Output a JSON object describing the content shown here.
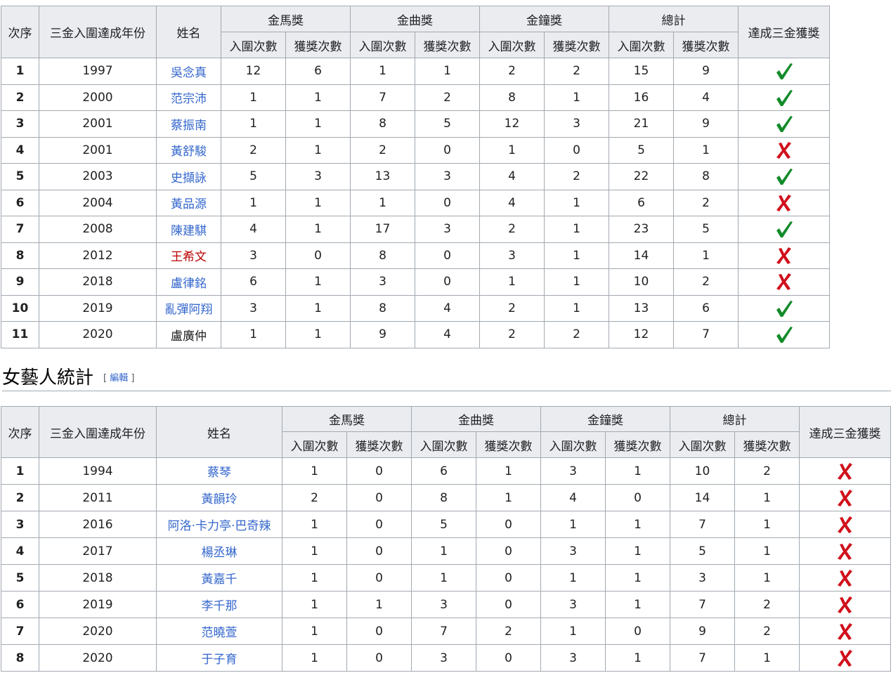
{
  "columns": {
    "order": "次序",
    "year": "三金入圍達成年份",
    "name": "姓名",
    "golden_horse": "金馬獎",
    "golden_melody": "金曲獎",
    "golden_bell": "金鐘獎",
    "total": "總計",
    "achieved": "達成三金獲獎",
    "nominations": "入圍次數",
    "wins": "獲獎次數"
  },
  "marks": {
    "yes": "check-icon",
    "no": "cross-icon",
    "yes_color": "#138b2a",
    "no_color": "#d0101b"
  },
  "male_table": {
    "rows": [
      {
        "order": "1",
        "year": "1997",
        "name": "吳念真",
        "link": "blue",
        "horse_n": "12",
        "horse_w": "6",
        "melody_n": "1",
        "melody_w": "1",
        "bell_n": "2",
        "bell_w": "2",
        "total_n": "15",
        "total_w": "9",
        "achieved": true
      },
      {
        "order": "2",
        "year": "2000",
        "name": "范宗沛",
        "link": "blue",
        "horse_n": "1",
        "horse_w": "1",
        "melody_n": "7",
        "melody_w": "2",
        "bell_n": "8",
        "bell_w": "1",
        "total_n": "16",
        "total_w": "4",
        "achieved": true
      },
      {
        "order": "3",
        "year": "2001",
        "name": "蔡振南",
        "link": "blue",
        "horse_n": "1",
        "horse_w": "1",
        "melody_n": "8",
        "melody_w": "5",
        "bell_n": "12",
        "bell_w": "3",
        "total_n": "21",
        "total_w": "9",
        "achieved": true
      },
      {
        "order": "4",
        "year": "2001",
        "name": "黃舒駿",
        "link": "blue",
        "horse_n": "2",
        "horse_w": "1",
        "melody_n": "2",
        "melody_w": "0",
        "bell_n": "1",
        "bell_w": "0",
        "total_n": "5",
        "total_w": "1",
        "achieved": false
      },
      {
        "order": "5",
        "year": "2003",
        "name": "史擷詠",
        "link": "blue",
        "horse_n": "5",
        "horse_w": "3",
        "melody_n": "13",
        "melody_w": "3",
        "bell_n": "4",
        "bell_w": "2",
        "total_n": "22",
        "total_w": "8",
        "achieved": true
      },
      {
        "order": "6",
        "year": "2004",
        "name": "黃品源",
        "link": "blue",
        "horse_n": "1",
        "horse_w": "1",
        "melody_n": "1",
        "melody_w": "0",
        "bell_n": "4",
        "bell_w": "1",
        "total_n": "6",
        "total_w": "2",
        "achieved": false
      },
      {
        "order": "7",
        "year": "2008",
        "name": "陳建騏",
        "link": "blue",
        "horse_n": "4",
        "horse_w": "1",
        "melody_n": "17",
        "melody_w": "3",
        "bell_n": "2",
        "bell_w": "1",
        "total_n": "23",
        "total_w": "5",
        "achieved": true
      },
      {
        "order": "8",
        "year": "2012",
        "name": "王希文",
        "link": "red",
        "horse_n": "3",
        "horse_w": "0",
        "melody_n": "8",
        "melody_w": "0",
        "bell_n": "3",
        "bell_w": "1",
        "total_n": "14",
        "total_w": "1",
        "achieved": false
      },
      {
        "order": "9",
        "year": "2018",
        "name": "盧律銘",
        "link": "blue",
        "horse_n": "6",
        "horse_w": "1",
        "melody_n": "3",
        "melody_w": "0",
        "bell_n": "1",
        "bell_w": "1",
        "total_n": "10",
        "total_w": "2",
        "achieved": false
      },
      {
        "order": "10",
        "year": "2019",
        "name": "亂彈阿翔",
        "link": "blue",
        "horse_n": "3",
        "horse_w": "1",
        "melody_n": "8",
        "melody_w": "4",
        "bell_n": "2",
        "bell_w": "1",
        "total_n": "13",
        "total_w": "6",
        "achieved": true
      },
      {
        "order": "11",
        "year": "2020",
        "name": "盧廣仲",
        "link": "none",
        "horse_n": "1",
        "horse_w": "1",
        "melody_n": "9",
        "melody_w": "4",
        "bell_n": "2",
        "bell_w": "2",
        "total_n": "12",
        "total_w": "7",
        "achieved": true
      }
    ]
  },
  "section": {
    "title": "女藝人統計",
    "edit_open": "[ ",
    "edit_label": "編輯",
    "edit_close": " ]"
  },
  "female_table": {
    "rows": [
      {
        "order": "1",
        "year": "1994",
        "name": "蔡琴",
        "link": "blue",
        "horse_n": "1",
        "horse_w": "0",
        "melody_n": "6",
        "melody_w": "1",
        "bell_n": "3",
        "bell_w": "1",
        "total_n": "10",
        "total_w": "2",
        "achieved": false
      },
      {
        "order": "2",
        "year": "2011",
        "name": "黃韻玲",
        "link": "blue",
        "horse_n": "2",
        "horse_w": "0",
        "melody_n": "8",
        "melody_w": "1",
        "bell_n": "4",
        "bell_w": "0",
        "total_n": "14",
        "total_w": "1",
        "achieved": false
      },
      {
        "order": "3",
        "year": "2016",
        "name": "阿洛·卡力亭·巴奇辣",
        "link": "blue",
        "horse_n": "1",
        "horse_w": "0",
        "melody_n": "5",
        "melody_w": "0",
        "bell_n": "1",
        "bell_w": "1",
        "total_n": "7",
        "total_w": "1",
        "achieved": false
      },
      {
        "order": "4",
        "year": "2017",
        "name": "楊丞琳",
        "link": "blue",
        "horse_n": "1",
        "horse_w": "0",
        "melody_n": "1",
        "melody_w": "0",
        "bell_n": "3",
        "bell_w": "1",
        "total_n": "5",
        "total_w": "1",
        "achieved": false
      },
      {
        "order": "5",
        "year": "2018",
        "name": "黃嘉千",
        "link": "blue",
        "horse_n": "1",
        "horse_w": "0",
        "melody_n": "1",
        "melody_w": "0",
        "bell_n": "1",
        "bell_w": "1",
        "total_n": "3",
        "total_w": "1",
        "achieved": false
      },
      {
        "order": "6",
        "year": "2019",
        "name": "李千那",
        "link": "blue",
        "horse_n": "1",
        "horse_w": "1",
        "melody_n": "3",
        "melody_w": "0",
        "bell_n": "3",
        "bell_w": "1",
        "total_n": "7",
        "total_w": "2",
        "achieved": false
      },
      {
        "order": "7",
        "year": "2020",
        "name": "范曉萱",
        "link": "blue",
        "horse_n": "1",
        "horse_w": "0",
        "melody_n": "7",
        "melody_w": "2",
        "bell_n": "1",
        "bell_w": "0",
        "total_n": "9",
        "total_w": "2",
        "achieved": false
      },
      {
        "order": "8",
        "year": "2020",
        "name": "于子育",
        "link": "blue",
        "horse_n": "1",
        "horse_w": "0",
        "melody_n": "3",
        "melody_w": "0",
        "bell_n": "3",
        "bell_w": "1",
        "total_n": "7",
        "total_w": "1",
        "achieved": false
      }
    ]
  }
}
